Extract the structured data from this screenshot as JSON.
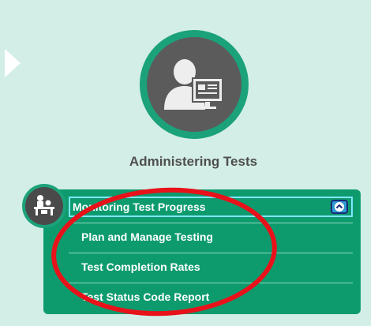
{
  "section": {
    "title": "Administering Tests",
    "hero_icon": "person-at-computer-icon",
    "menu_icon": "classroom-icon"
  },
  "menu": {
    "header_label": "Monitoring Test Progress",
    "toggle_icon": "chevron-up-icon",
    "items": [
      {
        "label": "Plan and Manage Testing"
      },
      {
        "label": "Test Completion Rates"
      },
      {
        "label": "Test Status Code Report"
      }
    ]
  },
  "colors": {
    "panel_bg": "#d3eee6",
    "brand_green": "#0d9b6e",
    "ring_green": "#1ba27a",
    "icon_gray": "#5b5b5b",
    "annotation_red": "#e8121a"
  }
}
